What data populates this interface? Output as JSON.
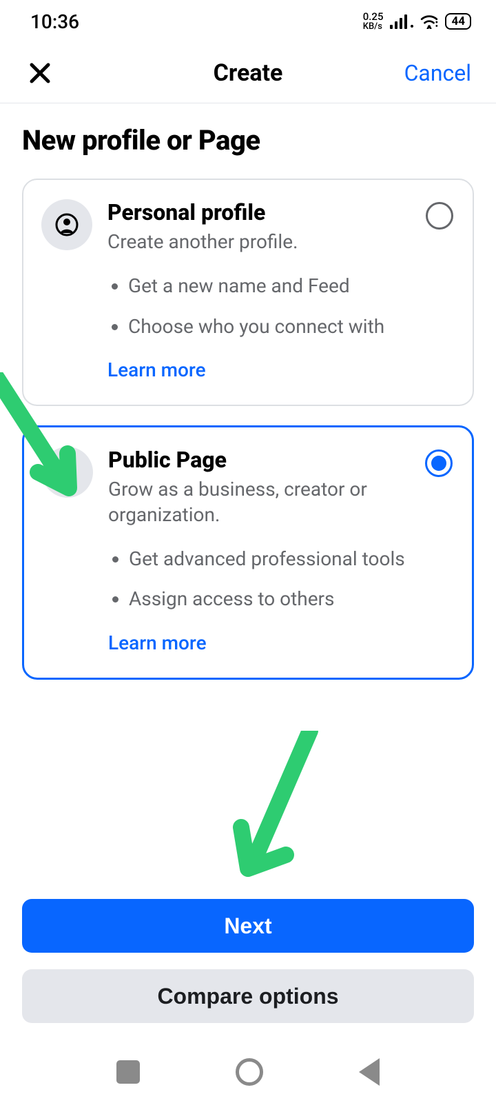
{
  "status": {
    "time": "10:36",
    "data_rate_top": "0.25",
    "data_rate_bottom": "KB/s",
    "battery": "44"
  },
  "header": {
    "title": "Create",
    "cancel": "Cancel"
  },
  "page": {
    "title": "New profile or Page"
  },
  "options": [
    {
      "title": "Personal profile",
      "desc": "Create another profile.",
      "bullets": [
        "Get a new name and Feed",
        "Choose who you connect with"
      ],
      "learn_more": "Learn more",
      "selected": false
    },
    {
      "title": "Public Page",
      "desc": "Grow as a business, creator or organization.",
      "bullets": [
        "Get advanced professional tools",
        "Assign access to others"
      ],
      "learn_more": "Learn more",
      "selected": true
    }
  ],
  "buttons": {
    "next": "Next",
    "compare": "Compare options"
  }
}
